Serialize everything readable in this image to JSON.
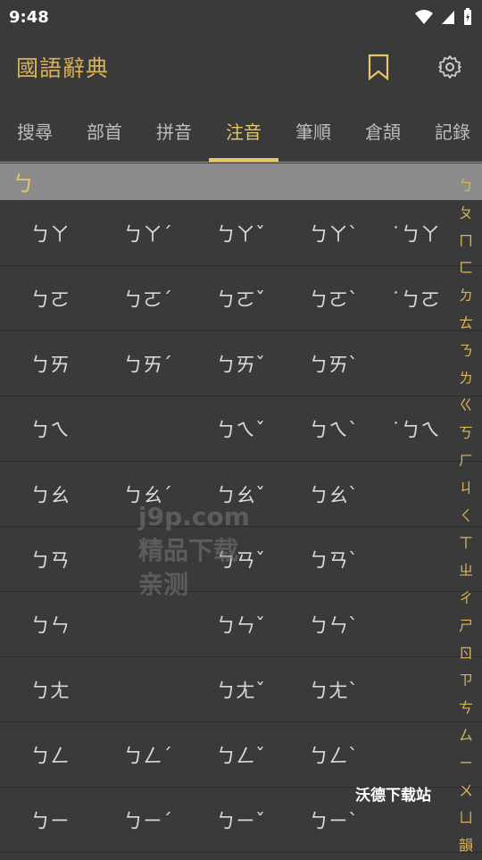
{
  "status": {
    "time": "9:48"
  },
  "app": {
    "title": "國語辭典",
    "icons": {
      "bookmark": "bookmark-icon",
      "settings": "gear-icon"
    }
  },
  "tabs": [
    {
      "label": "搜尋"
    },
    {
      "label": "部首"
    },
    {
      "label": "拼音"
    },
    {
      "label": "注音",
      "active": true
    },
    {
      "label": "筆順"
    },
    {
      "label": "倉頡"
    },
    {
      "label": "記錄"
    }
  ],
  "section": {
    "header": "ㄅ"
  },
  "rows": [
    [
      "ㄅㄚ",
      "ㄅㄚˊ",
      "ㄅㄚˇ",
      "ㄅㄚˋ",
      "˙ㄅㄚ"
    ],
    [
      "ㄅㄛ",
      "ㄅㄛˊ",
      "ㄅㄛˇ",
      "ㄅㄛˋ",
      "˙ㄅㄛ"
    ],
    [
      "ㄅㄞ",
      "ㄅㄞˊ",
      "ㄅㄞˇ",
      "ㄅㄞˋ",
      ""
    ],
    [
      "ㄅㄟ",
      "",
      "ㄅㄟˇ",
      "ㄅㄟˋ",
      "˙ㄅㄟ"
    ],
    [
      "ㄅㄠ",
      "ㄅㄠˊ",
      "ㄅㄠˇ",
      "ㄅㄠˋ",
      ""
    ],
    [
      "ㄅㄢ",
      "",
      "ㄅㄢˇ",
      "ㄅㄢˋ",
      ""
    ],
    [
      "ㄅㄣ",
      "",
      "ㄅㄣˇ",
      "ㄅㄣˋ",
      ""
    ],
    [
      "ㄅㄤ",
      "",
      "ㄅㄤˇ",
      "ㄅㄤˋ",
      ""
    ],
    [
      "ㄅㄥ",
      "ㄅㄥˊ",
      "ㄅㄥˇ",
      "ㄅㄥˋ",
      ""
    ],
    [
      "ㄅㄧ",
      "ㄅㄧˊ",
      "ㄅㄧˇ",
      "ㄅㄧˋ",
      ""
    ]
  ],
  "index": [
    "ㄅ",
    "ㄆ",
    "ㄇ",
    "ㄈ",
    "ㄉ",
    "ㄊ",
    "ㄋ",
    "ㄌ",
    "ㄍ",
    "ㄎ",
    "ㄏ",
    "ㄐ",
    "ㄑ",
    "ㄒ",
    "ㄓ",
    "ㄔ",
    "ㄕ",
    "ㄖ",
    "ㄗ",
    "ㄘ",
    "ㄙ",
    "ㄧ",
    "ㄨ",
    "ㄩ",
    "韻"
  ],
  "watermark": {
    "line1": "j9p.com",
    "line2": "精品下载",
    "line3": "亲测"
  },
  "watermark2": "沃德下载站",
  "colors": {
    "accent": "#e6c56b",
    "background": "#3a3a3a",
    "header": "#8c8c8c"
  }
}
